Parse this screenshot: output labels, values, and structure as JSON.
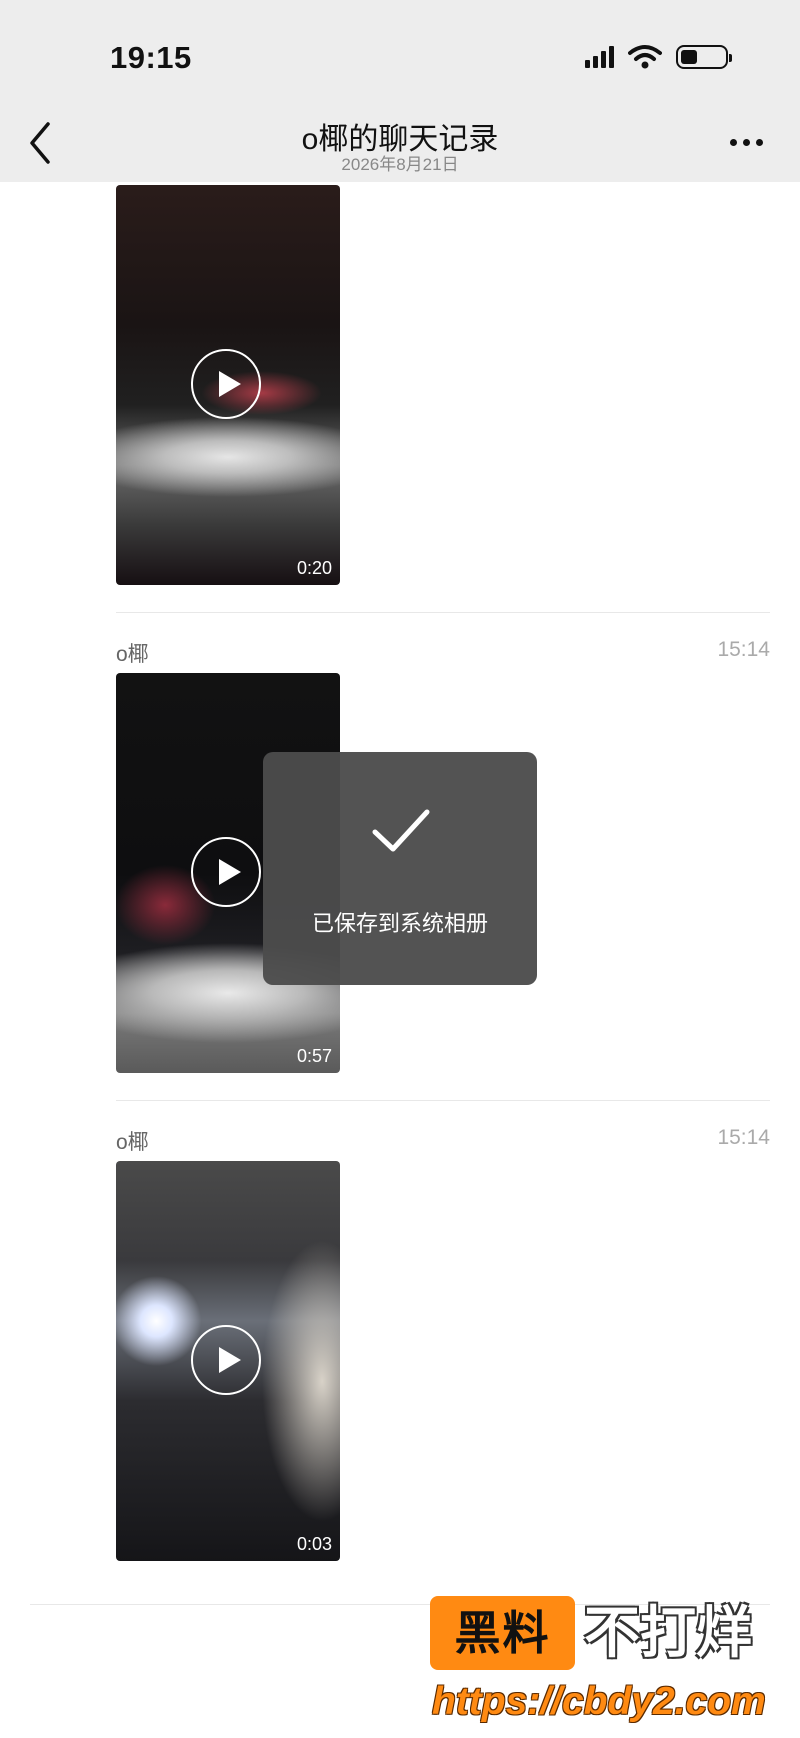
{
  "status_bar": {
    "time": "19:15",
    "icons": [
      "signal-icon",
      "wifi-icon",
      "battery-icon"
    ]
  },
  "nav": {
    "title": "o椰的聊天记录",
    "subtitle": "2026年8月21日",
    "back_icon": "chevron-left-icon",
    "more_icon": "more-icon"
  },
  "messages": [
    {
      "sender": "",
      "time": "",
      "duration": "0:20"
    },
    {
      "sender": "o椰",
      "time": "15:14",
      "duration": "0:57"
    },
    {
      "sender": "o椰",
      "time": "15:14",
      "duration": "0:03"
    }
  ],
  "toast": {
    "icon": "check-icon",
    "text": "已保存到系统相册"
  },
  "watermark": {
    "box_text": "黑料",
    "text": "不打烊",
    "url": "https://cbdy2.com"
  },
  "colors": {
    "nav_bg": "#ededed",
    "toast_bg": "#4c4c4c",
    "watermark_orange": "#ff8a12"
  }
}
